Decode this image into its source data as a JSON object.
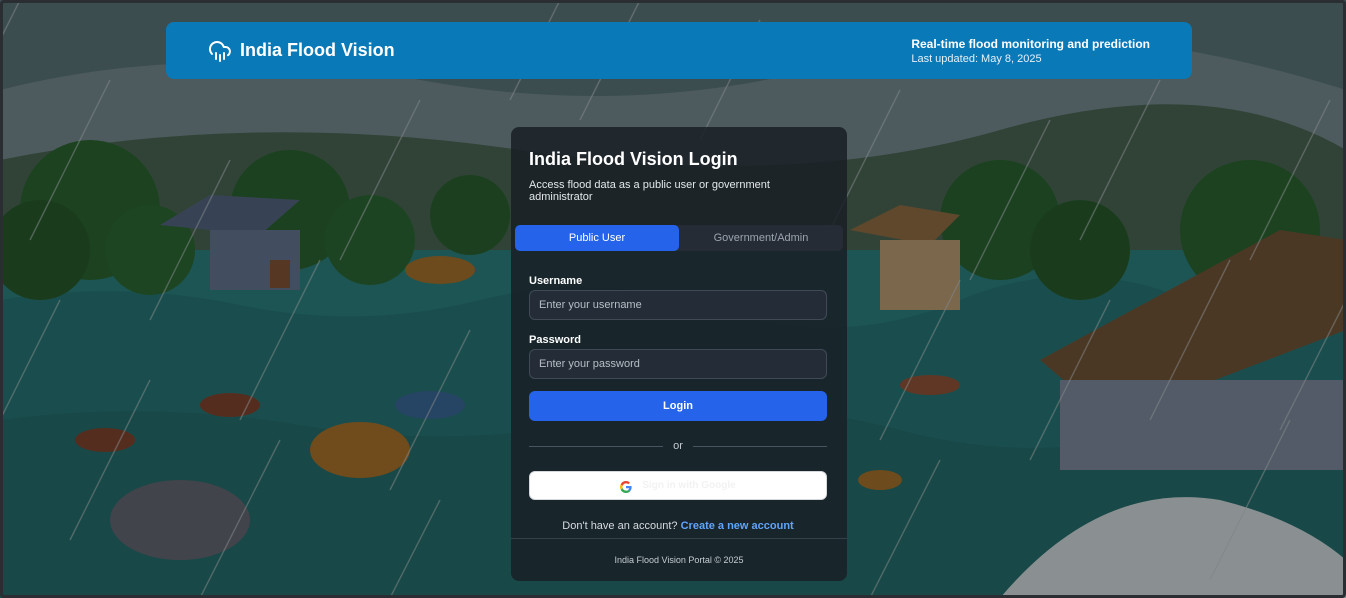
{
  "header": {
    "icon": "cloud-rain-icon",
    "brand": "India Flood Vision",
    "tagline": "Real-time flood monitoring and prediction",
    "last_updated": "Last updated: May 8, 2025",
    "color": "#0979b8"
  },
  "login": {
    "title": "India Flood Vision Login",
    "subtitle": "Access flood data as a public user or government administrator",
    "tabs": [
      {
        "label": "Public User",
        "active": true
      },
      {
        "label": "Government/Admin",
        "active": false
      }
    ],
    "username": {
      "label": "Username",
      "placeholder": "Enter your username",
      "value": ""
    },
    "password": {
      "label": "Password",
      "placeholder": "Enter your password",
      "value": ""
    },
    "login_label": "Login",
    "divider": "or",
    "google_label": "Sign in with Google",
    "signup_prompt": "Don't have an account?",
    "signup_link": "Create a new account",
    "footer": "India Flood Vision Portal © 2025",
    "accent": "#2563eb"
  }
}
